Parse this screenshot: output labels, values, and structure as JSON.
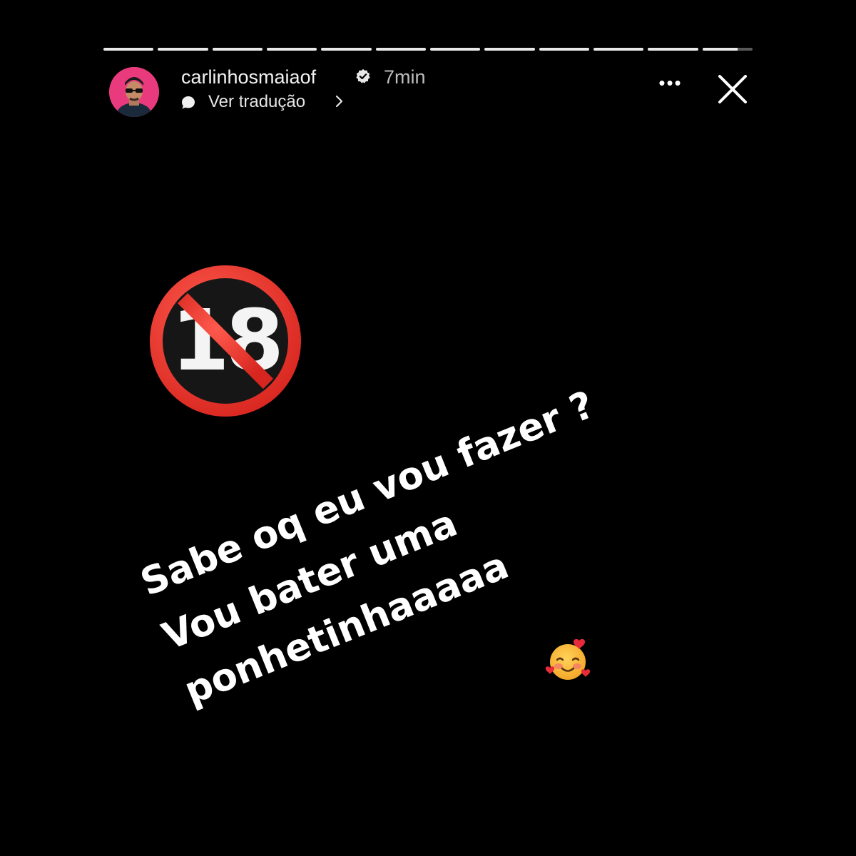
{
  "story": {
    "progress_segments": [
      1,
      1,
      1,
      1,
      1,
      1,
      1,
      1,
      1,
      1,
      1,
      0.7
    ],
    "username": "carlinhosmaiaof",
    "verified": true,
    "time_ago": "7min",
    "translate_label": "Ver tradução",
    "more_label": "•••",
    "icons": {
      "avatar": "avatar",
      "verified": "verified-badge-icon",
      "translate_bubble": "speech-bubble-icon",
      "translate_chevron": "chevron-right-icon",
      "more": "more-options-icon",
      "close": "close-icon"
    }
  },
  "content": {
    "sticker": {
      "name": "no-one-under-eighteen-emoji",
      "text": "18"
    },
    "caption_lines": [
      "Sabe oq eu vou fazer ?",
      "Vou bater uma",
      "ponhetinhaaaaa"
    ],
    "caption_emoji": "smiling-face-with-hearts-emoji"
  },
  "colors": {
    "background": "#000000",
    "avatar_ring": "#e83a7d",
    "prohibited_red": "#e8302c"
  }
}
